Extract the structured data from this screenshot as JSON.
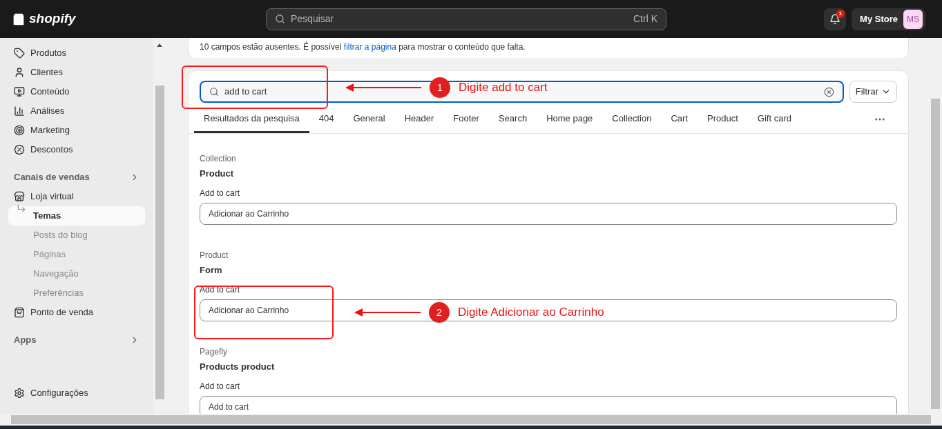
{
  "topbar": {
    "logo": "shopify",
    "search": {
      "placeholder": "Pesquisar",
      "shortcut": "Ctrl K"
    },
    "notifications": {
      "count": "1"
    },
    "store": {
      "name": "My Store",
      "initials": "MS"
    }
  },
  "sidebar": {
    "items": [
      {
        "kind": "item",
        "label": "Produtos"
      },
      {
        "kind": "item",
        "label": "Clientes"
      },
      {
        "kind": "item",
        "label": "Conteúdo"
      },
      {
        "kind": "item",
        "label": "Análises"
      },
      {
        "kind": "item",
        "label": "Marketing"
      },
      {
        "kind": "item",
        "label": "Descontos"
      },
      {
        "kind": "section",
        "label": "Canais de vendas"
      },
      {
        "kind": "item",
        "label": "Loja virtual"
      },
      {
        "kind": "sub",
        "label": "Temas",
        "selected": true
      },
      {
        "kind": "sub",
        "label": "Posts do blog",
        "selected": false
      },
      {
        "kind": "sub",
        "label": "Páginas",
        "selected": false
      },
      {
        "kind": "sub",
        "label": "Navegação",
        "selected": false
      },
      {
        "kind": "sub",
        "label": "Preferências",
        "selected": false
      },
      {
        "kind": "item",
        "label": "Ponto de venda"
      },
      {
        "kind": "section",
        "label": "Apps"
      }
    ],
    "footer": "Configurações"
  },
  "notice": {
    "before": "10 campos estão ausentes. É possível",
    "link": "filtrar a página",
    "after": "para mostrar o conteúdo que falta."
  },
  "search": {
    "value": "add to cart",
    "filter_button": "Filtrar"
  },
  "tabs": [
    {
      "label": "Resultados da pesquisa",
      "selected": true
    },
    {
      "label": "404",
      "selected": false
    },
    {
      "label": "General",
      "selected": false
    },
    {
      "label": "Header",
      "selected": false
    },
    {
      "label": "Footer",
      "selected": false
    },
    {
      "label": "Search",
      "selected": false
    },
    {
      "label": "Home page",
      "selected": false
    },
    {
      "label": "Collection",
      "selected": false
    },
    {
      "label": "Cart",
      "selected": false
    },
    {
      "label": "Product",
      "selected": false
    },
    {
      "label": "Gift card",
      "selected": false
    }
  ],
  "results": [
    {
      "group": "Collection",
      "title": "Product",
      "label": "Add to cart",
      "value": "Adicionar ao Carrinho"
    },
    {
      "group": "Product",
      "title": "Form",
      "label": "Add to cart",
      "value": "Adicionar ao Carrinho"
    },
    {
      "group": "Pagefly",
      "title": "Products product",
      "label": "Add to cart",
      "value": "Add to cart"
    }
  ],
  "annotations": [
    {
      "number": "1",
      "text": "Digite add to cart"
    },
    {
      "number": "2",
      "text": "Digite Adicionar ao Carrinho"
    }
  ]
}
